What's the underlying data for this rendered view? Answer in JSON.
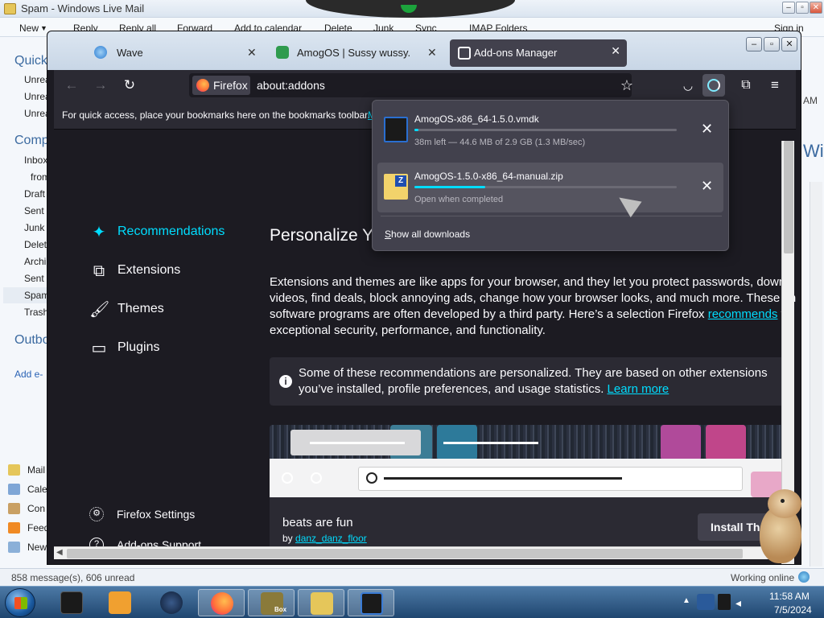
{
  "wlm": {
    "title": "Spam - Windows Live Mail",
    "menu": [
      "New",
      "Reply",
      "Reply all",
      "Forward",
      "Add to calendar",
      "Delete",
      "Junk",
      "Sync",
      "IMAP Folders",
      "Sign in"
    ],
    "sidebar": {
      "quick": "Quick",
      "unread": [
        "Unrea",
        "Unrea",
        "Unrea"
      ],
      "comp": "Comp",
      "folders": [
        "Inbox",
        "from",
        "Draft",
        "Sent",
        "Junk",
        "Delet",
        "Archi",
        "Sent",
        "Spam",
        "Trash"
      ],
      "outbox": "Outbo",
      "add": "Add e-"
    },
    "bottom_nav": [
      "Mail",
      "Cale",
      "Con",
      "Feed",
      "New"
    ],
    "right_clip": {
      "am": "AM",
      "wi": "Wi"
    },
    "status_left": "858 message(s), 606 unread",
    "status_right": "Working online"
  },
  "taskbar": {
    "time": "11:58 AM",
    "date": "7/5/2024",
    "box_label": "Box"
  },
  "firefox": {
    "tabs": [
      {
        "label": "Wave"
      },
      {
        "label": "AmogOS | Sussy wussy."
      },
      {
        "label": "Add-ons Manager"
      }
    ],
    "identity_label": "Firefox",
    "url": "about:addons",
    "bookmarks_hint": "For quick access, place your bookmarks here on the bookmarks toolbar.",
    "bookmarks_link": "M",
    "categories": [
      "Recommendations",
      "Extensions",
      "Themes",
      "Plugins"
    ],
    "footer": [
      "Firefox Settings",
      "Add-ons Support"
    ],
    "heading": "Personalize Yo",
    "desc_pre": "Extensions and themes are like apps for your browser, and they let you protect passwords, downl videos, find deals, block annoying ads, change how your browser looks, and much more. These sn software programs are often developed by a third party. Here’s a selection Firefox ",
    "desc_link": "recommends",
    "desc_post": " f exceptional security, performance, and functionality.",
    "notice_text": "Some of these recommendations are personalized. They are based on other extensions you’ve installed, profile preferences, and usage statistics. ",
    "notice_link": "Learn more",
    "theme_name": "beats are fun",
    "theme_by": "by ",
    "theme_author": "danz_danz_floor",
    "install_label": "Install The"
  },
  "downloads": {
    "items": [
      {
        "name": "AmogOS-x86_64-1.5.0.vmdk",
        "status": "38m left — 44.6 MB of 2.9 GB (1.3 MB/sec)",
        "progress": 0.015
      },
      {
        "name": "AmogOS-1.5.0-x86_64-manual.zip",
        "status": "Open when completed",
        "progress": 0.27
      }
    ],
    "show_all": "Show all downloads"
  }
}
